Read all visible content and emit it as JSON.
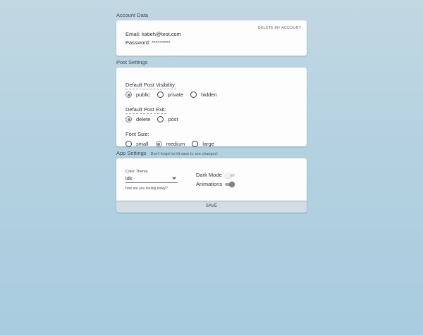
{
  "account": {
    "title": "Account Data",
    "delete_label": "DELETE MY ACCOUNT",
    "email_label": "Email:",
    "email_value": "katieh@test.com",
    "password_label": "Password:",
    "password_value": "*********"
  },
  "post_settings": {
    "title": "Post Settings",
    "visibility": {
      "label": "Default Post Visibility:",
      "options": [
        "public",
        "private",
        "hidden"
      ],
      "selected": "public"
    },
    "exit": {
      "label": "Default Post Exit:",
      "options": [
        "delete",
        "post"
      ],
      "selected": "delete"
    },
    "font_size": {
      "label": "Font Size:",
      "options": [
        "small",
        "medium",
        "large"
      ],
      "selected": "medium"
    }
  },
  "app_settings": {
    "title": "App Settings",
    "hint": "Don't forget to hit save to see changes!",
    "color_theme": {
      "label": "Color Theme",
      "value": "idk",
      "hint": "how are you feeling today?"
    },
    "dark_mode": {
      "label": "Dark Mode",
      "on": false
    },
    "animations": {
      "label": "Animations",
      "on": true
    }
  },
  "save_label": "SAVE",
  "colors": {
    "background_top": "#c2d8e3",
    "background_bottom": "#a9cce0",
    "card": "#fdfdfe",
    "save_button": "#d3dde3"
  }
}
